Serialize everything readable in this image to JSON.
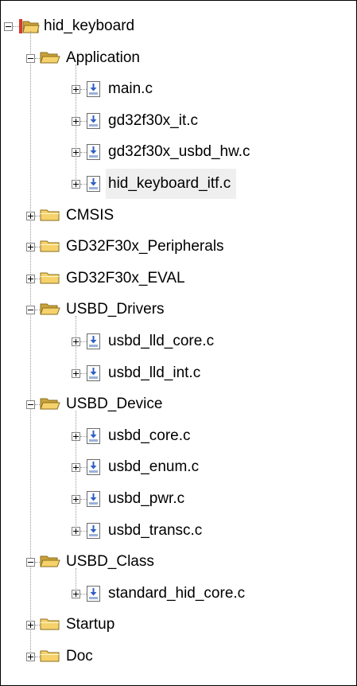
{
  "tree": {
    "root": {
      "label": "hid_keyboard",
      "icon": "project-root-icon",
      "expanded": true
    },
    "items": [
      {
        "label": "Application",
        "type": "folder",
        "depth": 1,
        "expanded": true
      },
      {
        "label": "main.c",
        "type": "file",
        "depth": 2
      },
      {
        "label": "gd32f30x_it.c",
        "type": "file",
        "depth": 2
      },
      {
        "label": "gd32f30x_usbd_hw.c",
        "type": "file",
        "depth": 2
      },
      {
        "label": "hid_keyboard_itf.c",
        "type": "file",
        "depth": 2,
        "selected": true
      },
      {
        "label": "CMSIS",
        "type": "folder",
        "depth": 1,
        "expanded": false
      },
      {
        "label": "GD32F30x_Peripherals",
        "type": "folder",
        "depth": 1,
        "expanded": false
      },
      {
        "label": "GD32F30x_EVAL",
        "type": "folder",
        "depth": 1,
        "expanded": false
      },
      {
        "label": "USBD_Drivers",
        "type": "folder",
        "depth": 1,
        "expanded": true
      },
      {
        "label": "usbd_lld_core.c",
        "type": "file",
        "depth": 2
      },
      {
        "label": "usbd_lld_int.c",
        "type": "file",
        "depth": 2
      },
      {
        "label": "USBD_Device",
        "type": "folder",
        "depth": 1,
        "expanded": true
      },
      {
        "label": "usbd_core.c",
        "type": "file",
        "depth": 2
      },
      {
        "label": "usbd_enum.c",
        "type": "file",
        "depth": 2
      },
      {
        "label": "usbd_pwr.c",
        "type": "file",
        "depth": 2
      },
      {
        "label": "usbd_transc.c",
        "type": "file",
        "depth": 2
      },
      {
        "label": "USBD_Class",
        "type": "folder",
        "depth": 1,
        "expanded": true
      },
      {
        "label": "standard_hid_core.c",
        "type": "file",
        "depth": 2
      },
      {
        "label": "Startup",
        "type": "folder",
        "depth": 1,
        "expanded": false
      },
      {
        "label": "Doc",
        "type": "folder",
        "depth": 1,
        "expanded": false
      }
    ]
  },
  "colors": {
    "folder": "#f5d26b",
    "folder_dark": "#c9a33a",
    "file_arrow": "#2f5fc4",
    "selection_bg": "#efefef",
    "text": "#000000"
  }
}
